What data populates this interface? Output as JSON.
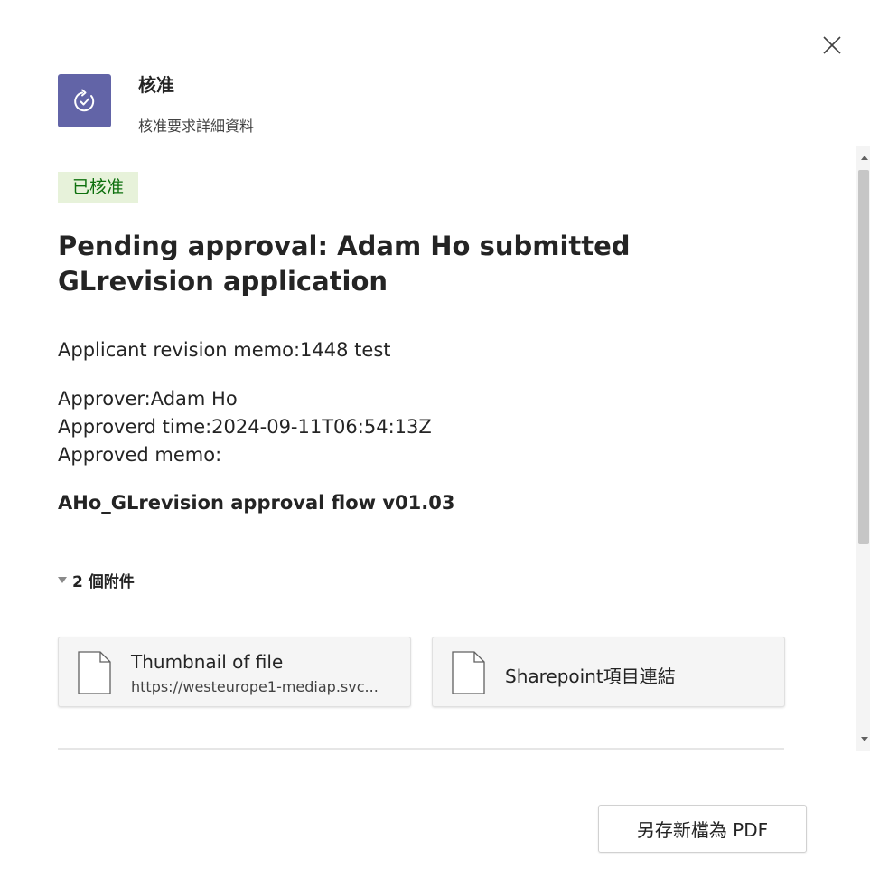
{
  "header": {
    "app_name": "核准",
    "subtitle": "核准要求詳細資料",
    "app_icon": "approval-check-icon",
    "close_icon": "close-icon"
  },
  "colors": {
    "app_icon_bg": "#6264a7",
    "badge_bg": "#e7f2da",
    "badge_text": "#0e700e"
  },
  "request": {
    "status": "已核准",
    "title": "Pending approval: Adam Ho submitted GLrevision application",
    "memo": "Applicant revision memo:1448 test",
    "approver": "Approver:Adam Ho",
    "approved_time": "Approverd time:2024-09-11T06:54:13Z",
    "approved_memo": "Approved memo:",
    "flow_name": "AHo_GLrevision approval flow v01.03"
  },
  "attachments": {
    "toggle_label": "2 個附件",
    "items": [
      {
        "name": "Thumbnail of file",
        "url": "https://westeurope1-mediap.svc...",
        "icon": "document-icon"
      },
      {
        "name": "Sharepoint項目連結",
        "url": "",
        "icon": "document-icon"
      }
    ]
  },
  "footer": {
    "save_pdf_label": "另存新檔為 PDF"
  }
}
